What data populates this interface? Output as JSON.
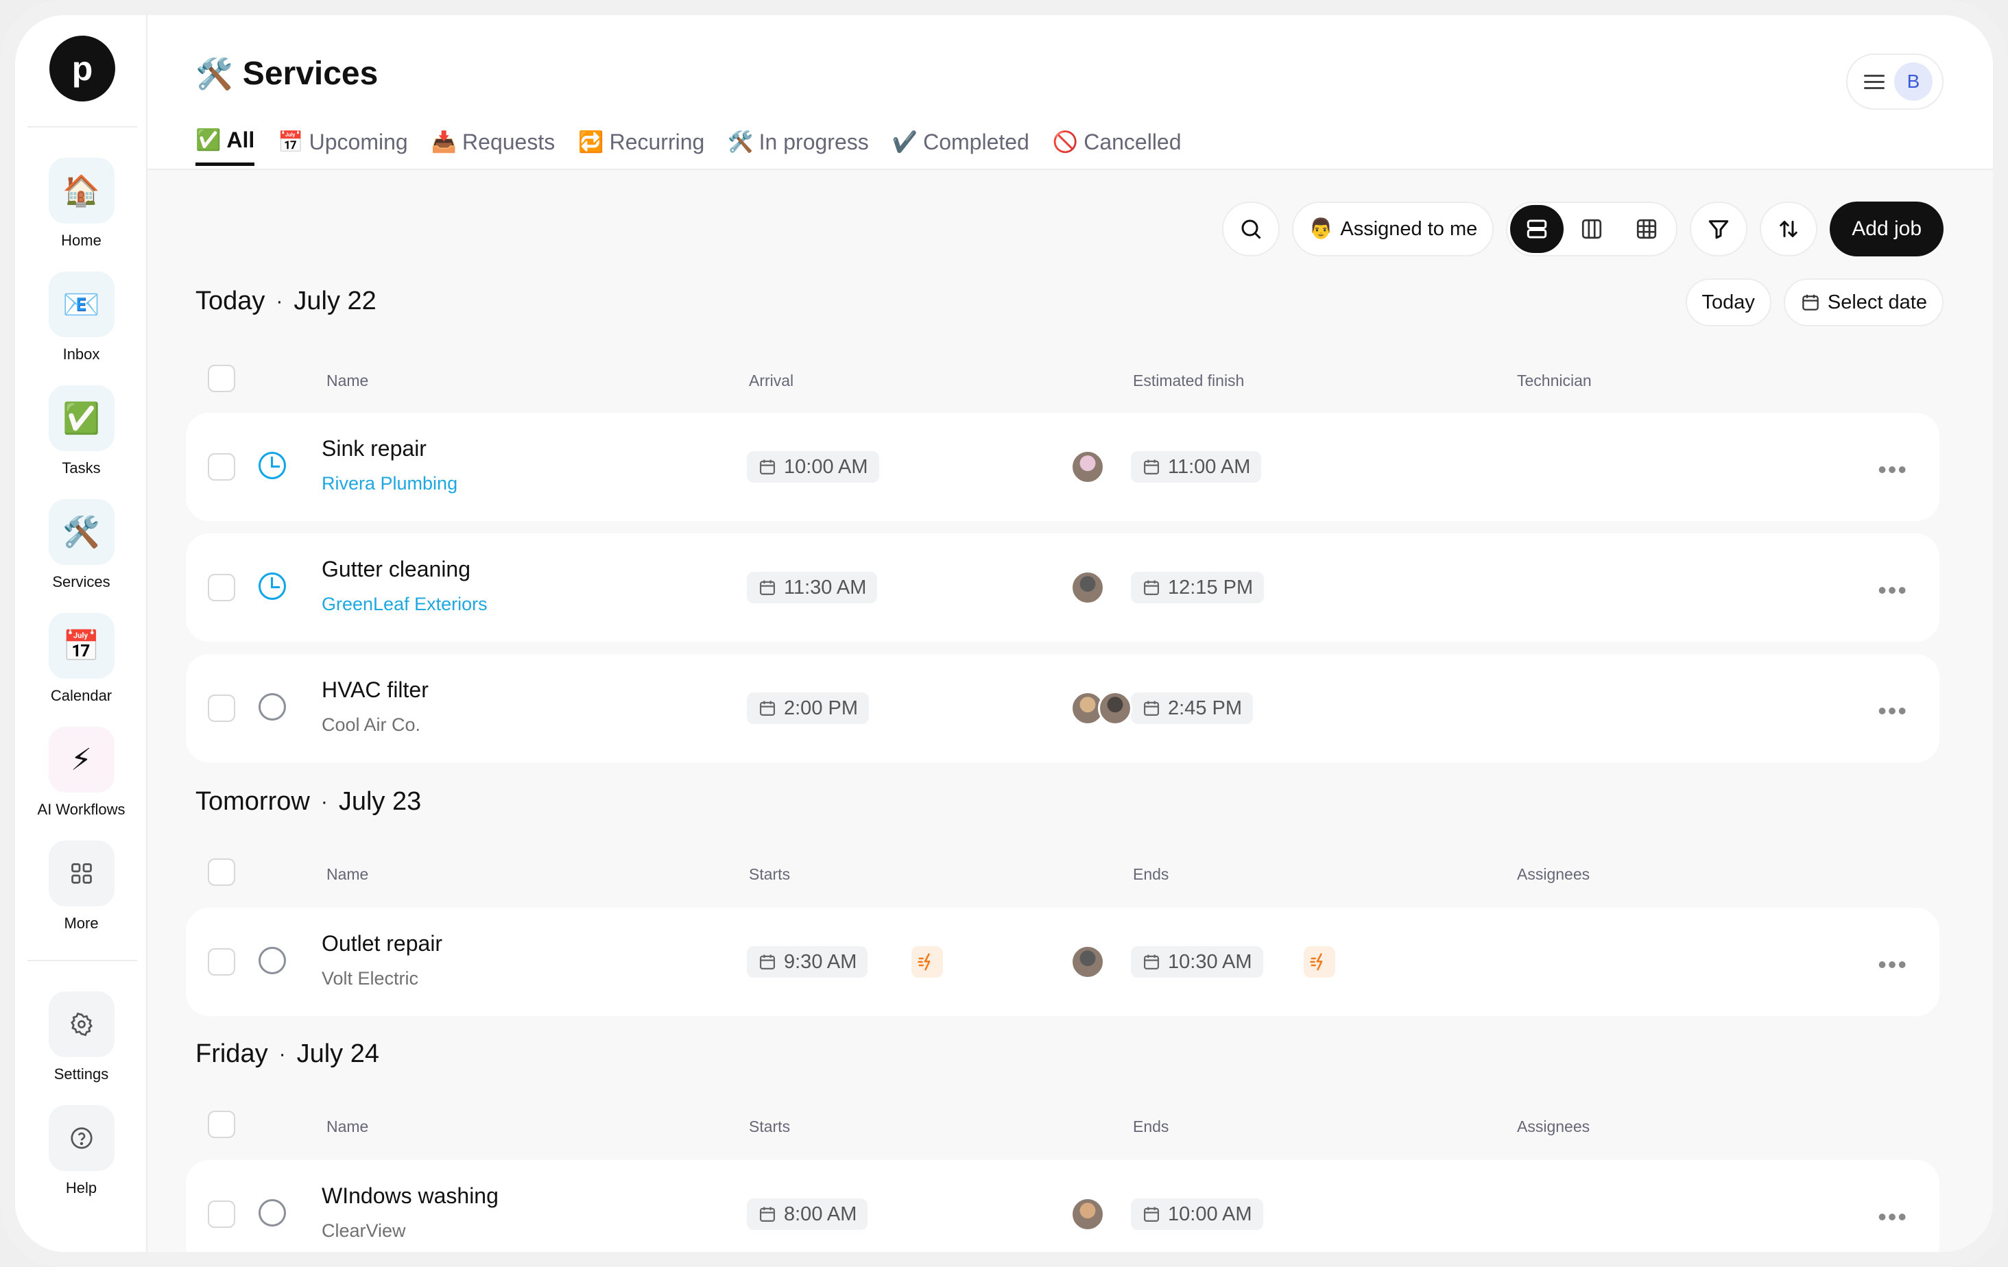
{
  "sidebar": {
    "logo": "p",
    "items": [
      {
        "label": "Home",
        "emoji": "🏠"
      },
      {
        "label": "Inbox",
        "emoji": "📧"
      },
      {
        "label": "Tasks",
        "emoji": "✅"
      },
      {
        "label": "Services",
        "emoji": "🛠️"
      },
      {
        "label": "Calendar",
        "emoji": "📅"
      },
      {
        "label": "AI Workflows",
        "emoji": "⚡"
      },
      {
        "label": "More",
        "icon": "grid-icon"
      },
      {
        "label": "Settings",
        "icon": "gear-icon"
      },
      {
        "label": "Help",
        "icon": "help-icon"
      }
    ]
  },
  "header": {
    "title_emoji": "🛠️",
    "title": "Services",
    "user_initial": "B"
  },
  "tabs": [
    {
      "emoji": "✅",
      "label": "All",
      "active": true
    },
    {
      "emoji": "📅",
      "label": "Upcoming"
    },
    {
      "emoji": "📥",
      "label": "Requests"
    },
    {
      "emoji": "🔁",
      "label": "Recurring"
    },
    {
      "emoji": "🛠️",
      "label": "In progress"
    },
    {
      "emoji": "✔️",
      "label": "Completed"
    },
    {
      "emoji": "🚫",
      "label": "Cancelled"
    }
  ],
  "toolbar": {
    "assigned_emoji": "👨",
    "assigned_label": "Assigned to me",
    "add_job": "Add job"
  },
  "date_buttons": {
    "today": "Today",
    "select_date": "Select date"
  },
  "sections": [
    {
      "day": "Today",
      "date": "July 22",
      "columns": [
        "Name",
        "Arrival",
        "Estimated finish",
        "Technician"
      ],
      "rows": [
        {
          "name": "Sink repair",
          "company": "Rivera Plumbing",
          "start": "10:00 AM",
          "end": "11:00 AM",
          "status": "in-progress",
          "company_link": true,
          "avatars": [
            "#e9c6d8"
          ]
        },
        {
          "name": "Gutter cleaning",
          "company": "GreenLeaf Exteriors",
          "start": "11:30 AM",
          "end": "12:15 PM",
          "status": "in-progress",
          "company_link": true,
          "avatars": [
            "#5a5a5a"
          ]
        },
        {
          "name": "HVAC filter",
          "company": "Cool Air Co.",
          "start": "2:00 PM",
          "end": "2:45 PM",
          "status": "open",
          "company_link": false,
          "avatars": [
            "#d9b48a",
            "#4a4440"
          ]
        }
      ]
    },
    {
      "day": "Tomorrow",
      "date": "July 23",
      "columns": [
        "Name",
        "Starts",
        "Ends",
        "Assignees"
      ],
      "rows": [
        {
          "name": "Outlet repair",
          "company": "Volt Electric",
          "start": "9:30 AM",
          "end": "10:30 AM",
          "status": "open",
          "company_link": false,
          "flash": true,
          "avatars": [
            "#5a5a5a"
          ]
        }
      ]
    },
    {
      "day": "Friday",
      "date": "July 24",
      "columns": [
        "Name",
        "Starts",
        "Ends",
        "Assignees"
      ],
      "rows": [
        {
          "name": "WIndows washing",
          "company": "ClearView",
          "start": "8:00 AM",
          "end": "10:00 AM",
          "status": "open",
          "company_link": false,
          "avatars": [
            "#d7aa80"
          ]
        }
      ]
    }
  ],
  "colors": {
    "accent": "#1ea7e0",
    "primary": "#111111",
    "flash": "#f07a1a"
  }
}
